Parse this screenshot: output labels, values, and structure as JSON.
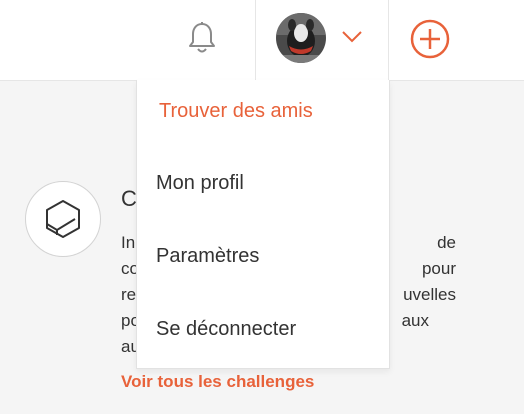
{
  "header": {
    "notifications_icon": "bell-icon",
    "user_menu_icon": "chevron-down-icon",
    "add_icon": "plus-circle-icon"
  },
  "dropdown": {
    "items": [
      {
        "label": "Trouver des amis",
        "accent": true
      },
      {
        "label": "Mon profil"
      },
      {
        "label": "Paramètres"
      },
      {
        "label": "Se déconnecter"
      }
    ]
  },
  "challenge": {
    "title": "C",
    "description": "In                                                         de\nco                                                        pour\nre                                                         uvelles\npo                                                          aux\nau",
    "see_all_label": "Voir tous les challenges"
  },
  "colors": {
    "accent": "#e8623a",
    "text": "#333333",
    "background": "#f5f5f5"
  }
}
